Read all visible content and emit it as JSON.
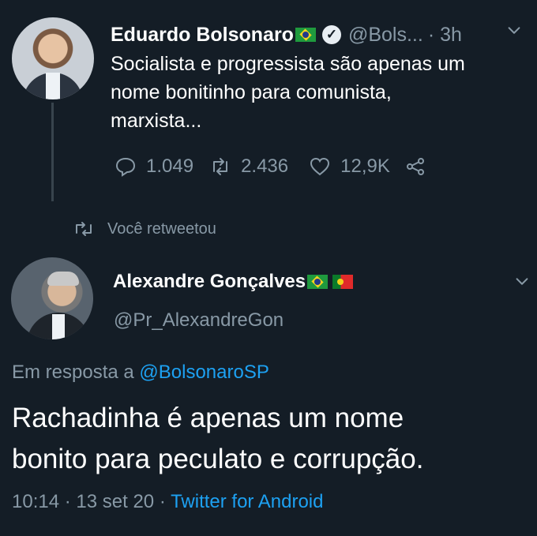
{
  "tweet1": {
    "author_name": "Eduardo Bolsonaro",
    "handle": "@Bols...",
    "time": "· 3h",
    "text_lines": [
      "Socialista e progressista são apenas um",
      "nome bonitinho para comunista,",
      "marxista..."
    ],
    "replies": "1.049",
    "retweets": "2.436",
    "likes": "12,9K",
    "icons": [
      "verified-icon",
      "chevron-down-icon",
      "reply-icon",
      "retweet-icon",
      "like-icon",
      "share-icon"
    ]
  },
  "retweet_note": {
    "label": "Você retweetou"
  },
  "tweet2": {
    "author_name": "Alexandre Gonçalves",
    "handle": "@Pr_AlexandreGon",
    "reply_prefix": "Em resposta a",
    "reply_mention": "@BolsonaroSP",
    "text_lines": [
      "Rachadinha é apenas um nome",
      "bonito para peculato e corrupção."
    ],
    "time": "10:14",
    "date": "13 set 20",
    "separator": "·",
    "client": "Twitter for Android"
  },
  "colors": {
    "background": "#141d26",
    "secondary_text": "#8899a6",
    "link": "#1da1f2"
  }
}
